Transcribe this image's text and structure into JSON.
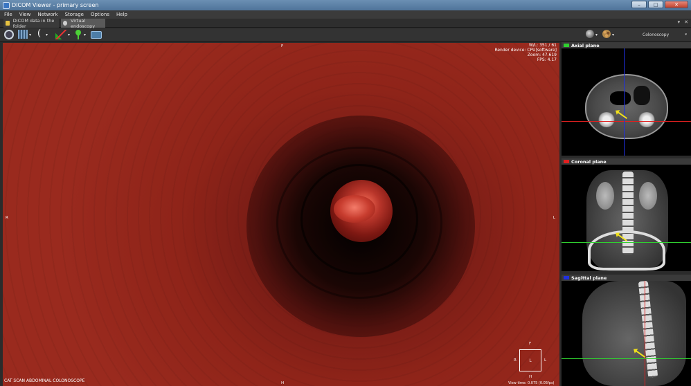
{
  "window": {
    "title": "DICOM Viewer - primary screen",
    "minimize": "–",
    "maximize": "□",
    "close": "✕"
  },
  "menu": [
    "File",
    "View",
    "Network",
    "Storage",
    "Options",
    "Help"
  ],
  "tabs": [
    {
      "label": "DICOM data in the folder",
      "icon": "folder-icon"
    },
    {
      "label": "Virtual endoscopy",
      "icon": "endoscope-icon"
    }
  ],
  "tab_controls": {
    "pin": "▾",
    "close": "✕"
  },
  "toolbar": {
    "tools": [
      "compass-icon",
      "grid-icon",
      "curve-icon",
      "angle-icon",
      "landmark-pin-icon",
      "camera-icon",
      "globe-icon",
      "palette-icon"
    ],
    "preset": "Colonoscopy",
    "arrow": "▾"
  },
  "viewport": {
    "info": {
      "wl": "W/L: 351 / 61",
      "render_device": "Render device: CPU[software]",
      "zoom": "Zoom: 47.619",
      "fps": "FPS: 4.17"
    },
    "orientation": {
      "top": "F",
      "bottom": "H",
      "left": "R",
      "right": "L"
    },
    "series": "CAT SCAN ABDOMINAL COLONOSCOPE",
    "cube": {
      "center": "L",
      "left": "R",
      "right": "L",
      "top": "F",
      "bottom": "H"
    },
    "footer": "View time: 0.075 (0.05fps)",
    "colors": {
      "wall": "#9a2a1e",
      "lumen": "#000000"
    }
  },
  "panels": [
    {
      "name": "axial",
      "label": "Axial plane",
      "color": "#2fd12f"
    },
    {
      "name": "coronal",
      "label": "Coronal plane",
      "color": "#e02020"
    },
    {
      "name": "sagittal",
      "label": "Sagittal plane",
      "color": "#2030e0"
    }
  ]
}
